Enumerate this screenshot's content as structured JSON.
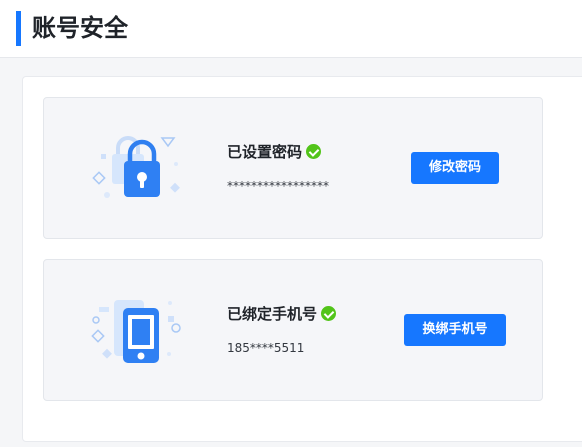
{
  "header": {
    "title": "账号安全"
  },
  "password": {
    "title": "已设置密码",
    "value": "*****************",
    "button": "修改密码",
    "icon": "lock-icon"
  },
  "phone": {
    "title": "已绑定手机号",
    "value": "185****5511",
    "button": "换绑手机号",
    "icon": "phone-icon"
  },
  "colors": {
    "accent": "#1677ff",
    "success": "#52c41a"
  }
}
